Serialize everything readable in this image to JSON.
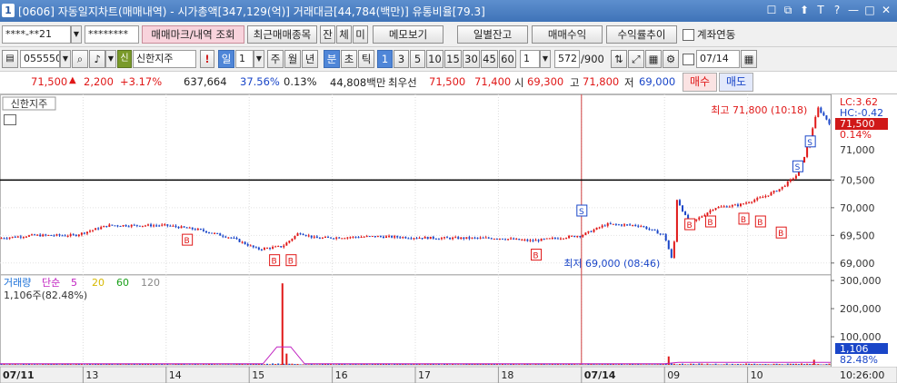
{
  "window": {
    "screen_no": "1",
    "title": "[0606] 자동일지차트(매매내역) - 시가총액[347,129(억)] 거래대금[44,784(백만)] 유통비율[79.3]",
    "title_icons": [
      "☐",
      "⧉",
      "⬆",
      "T",
      "?",
      "—",
      "□",
      "✕"
    ]
  },
  "toolbar1": {
    "account": "****-**21",
    "password": "********",
    "btn_trade_mark": "매매마크/내역 조회",
    "btn_recent_items": "최근매매종목",
    "btn_jan": "잔",
    "btn_che": "체",
    "btn_mi": "미",
    "btn_memo": "메모보기",
    "btn_daily_balance": "일별잔고",
    "btn_trade_profit": "매매수익",
    "btn_return_trend": "수익률추이",
    "chk_linked": "계좌연동"
  },
  "toolbar2": {
    "code": "055550",
    "badge": "신",
    "name": "신한지주",
    "period_day": "일",
    "period_num": "1",
    "periods": [
      "주",
      "월",
      "년",
      "분",
      "초",
      "틱"
    ],
    "minute_nums": [
      "1",
      "3",
      "5",
      "10",
      "15",
      "30",
      "45",
      "60"
    ],
    "count_select": "1",
    "count": "572",
    "count_total": "/900",
    "date": "07/14"
  },
  "quote": {
    "price": "71,500",
    "arrow": "▲",
    "change": "2,200",
    "change_pct": "+3.17%",
    "volume": "637,664",
    "vol_ratio": "37.56%",
    "turnover": "0.13%",
    "amount": "44,808백만",
    "best_label": "최우선",
    "ask": "71,500",
    "bid": "71,400",
    "open_label": "시",
    "open": "69,300",
    "high_label": "고",
    "high": "71,800",
    "low_label": "저",
    "low": "69,000",
    "buy_btn": "매수",
    "sell_btn": "매도"
  },
  "chart_data": [
    {
      "type": "candlestick",
      "title": "신한지주",
      "y_ticks": [
        "70,500",
        "70,000",
        "69,500",
        "69,000"
      ],
      "y_top_labels": [
        "LC:3.62",
        "HC:-0.42",
        "71,500",
        "0.14%",
        "71,000"
      ],
      "ylim": [
        68800,
        71950
      ],
      "current_price": 71500,
      "horizontal_line": 70500,
      "high_annotation": "최고 71,800 (10:18)",
      "low_annotation": "최저 69,000 (08:46)",
      "buy_marker": "B",
      "sell_marker": "S",
      "x_labels": [
        "07/11",
        "13",
        "14",
        "15",
        "16",
        "17",
        "18",
        "07/14",
        "09",
        "10"
      ],
      "x_label_sessions": [
        0,
        1,
        2,
        3,
        4,
        5,
        6,
        7,
        8,
        9
      ],
      "sessions": 10,
      "day_boundary_session": 7,
      "price_path": [
        [
          0,
          69450
        ],
        [
          0.4,
          69500
        ],
        [
          0.9,
          69500
        ],
        [
          1.3,
          69680
        ],
        [
          2.0,
          69680
        ],
        [
          2.4,
          69600
        ],
        [
          2.8,
          69450
        ],
        [
          3.1,
          69250
        ],
        [
          3.4,
          69300
        ],
        [
          3.6,
          69550
        ],
        [
          3.8,
          69450
        ],
        [
          4.5,
          69480
        ],
        [
          5.3,
          69450
        ],
        [
          6.0,
          69450
        ],
        [
          6.4,
          69400
        ],
        [
          7.0,
          69500
        ],
        [
          7.3,
          69700
        ],
        [
          7.7,
          69680
        ],
        [
          8.0,
          69500
        ],
        [
          8.1,
          69000
        ],
        [
          8.15,
          70150
        ],
        [
          8.3,
          69700
        ],
        [
          8.6,
          70000
        ],
        [
          8.9,
          70050
        ],
        [
          9.0,
          70100
        ],
        [
          9.2,
          70200
        ],
        [
          9.4,
          70350
        ],
        [
          9.6,
          70600
        ],
        [
          9.7,
          71000
        ],
        [
          9.85,
          71800
        ],
        [
          10.0,
          71500
        ]
      ],
      "buy_points": [
        [
          2.25,
          69520
        ],
        [
          3.3,
          69150
        ],
        [
          3.5,
          69150
        ],
        [
          6.45,
          69250
        ],
        [
          8.3,
          69800
        ],
        [
          8.55,
          69850
        ],
        [
          8.95,
          69900
        ],
        [
          9.15,
          69850
        ],
        [
          9.4,
          69650
        ]
      ],
      "sell_points": [
        [
          7.0,
          69850
        ],
        [
          9.6,
          70650
        ],
        [
          9.75,
          71100
        ]
      ]
    },
    {
      "type": "bar",
      "legend": [
        "거래량",
        "단순",
        "5",
        "20",
        "60",
        "120"
      ],
      "legend_colors": [
        "#1a70d8",
        "#c020c0",
        "#c020c0",
        "#d6b800",
        "#1aa01a",
        "#888888"
      ],
      "current_label": "1,106주(82.48%)",
      "y_ticks": [
        "300,000",
        "200,000",
        "100,000"
      ],
      "ylim": [
        0,
        310000
      ],
      "current_value": "1,106",
      "current_pct": "82.48%",
      "spikes": [
        [
          3.4,
          290000
        ],
        [
          3.45,
          40000
        ],
        [
          8.05,
          30000
        ],
        [
          9.8,
          18000
        ]
      ]
    }
  ],
  "time_now": "10:26:00",
  "colors": {
    "up": "#e01818",
    "down": "#1a46c8",
    "accent": "#4f86d8"
  }
}
